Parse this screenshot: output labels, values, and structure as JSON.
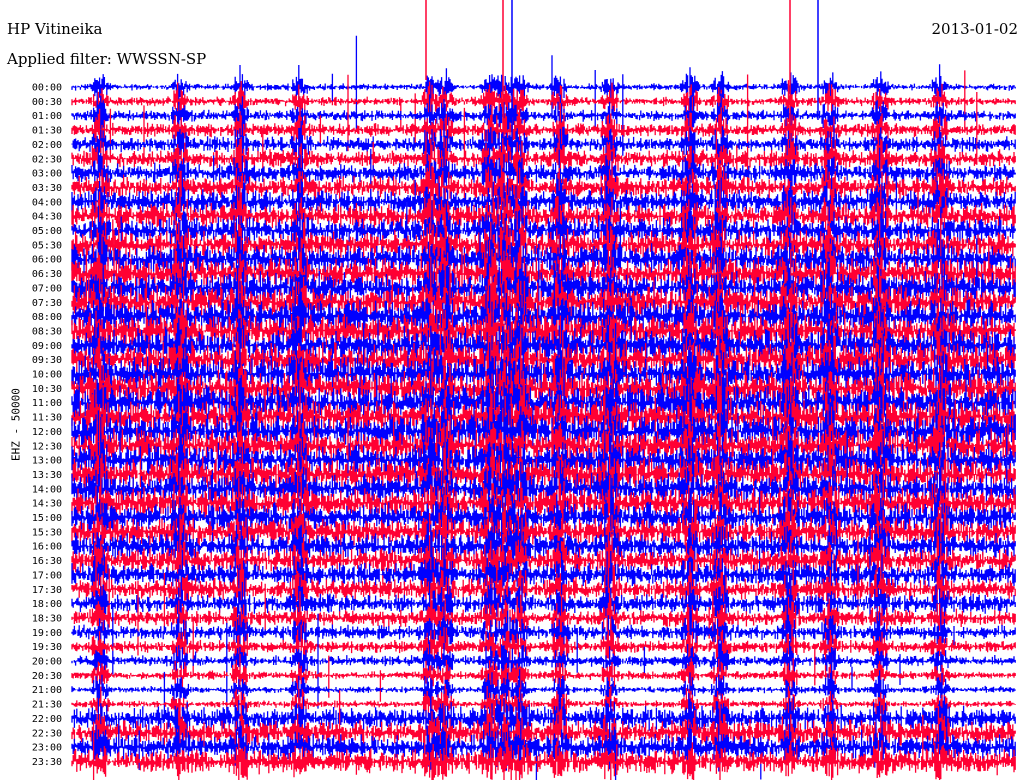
{
  "header": {
    "station": "HP Vitineika",
    "date": "2013-01-02",
    "filter": "Applied filter: WWSSN-SP"
  },
  "chart_data": {
    "type": "line",
    "title": "HP Vitineika",
    "date": "2013-01-02",
    "filter": "WWSSN-SP",
    "ylabel": "EHZ - 50000",
    "row_labels": [
      "00:00",
      "00:30",
      "01:00",
      "01:30",
      "02:00",
      "02:30",
      "03:00",
      "03:30",
      "04:00",
      "04:30",
      "05:00",
      "05:30",
      "06:00",
      "06:30",
      "07:00",
      "07:30",
      "08:00",
      "08:30",
      "09:00",
      "09:30",
      "10:00",
      "10:30",
      "11:00",
      "11:30",
      "12:00",
      "12:30",
      "13:00",
      "13:30",
      "14:00",
      "14:30",
      "15:00",
      "15:30",
      "16:00",
      "16:30",
      "17:00",
      "17:30",
      "18:00",
      "18:30",
      "19:00",
      "19:30",
      "20:00",
      "20:30",
      "21:00",
      "21:30",
      "22:00",
      "22:30",
      "23:00",
      "23:30"
    ],
    "series_colors": [
      "#0000ff",
      "#ff0033"
    ],
    "color_pattern": "alternating by row, starting blue at 00:00",
    "grid": false
  }
}
